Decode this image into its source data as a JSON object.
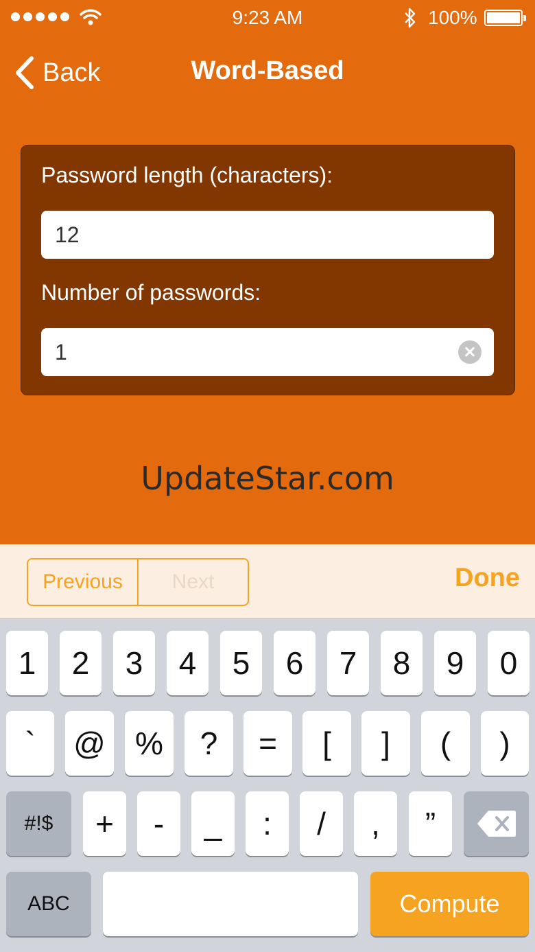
{
  "status_bar": {
    "time": "9:23 AM",
    "battery": "100%"
  },
  "nav": {
    "back_label": "Back",
    "title": "Word-Based"
  },
  "form": {
    "length_label": "Password length (characters):",
    "length_value": "12",
    "count_label": "Number of passwords:",
    "count_value": "1"
  },
  "watermark": "UpdateStar.com",
  "accessory": {
    "previous": "Previous",
    "next": "Next",
    "done": "Done"
  },
  "keyboard": {
    "row1": [
      "1",
      "2",
      "3",
      "4",
      "5",
      "6",
      "7",
      "8",
      "9",
      "0"
    ],
    "row2": [
      "`",
      "@",
      "%",
      "?",
      "=",
      "[",
      "]",
      "(",
      ")"
    ],
    "row3_mode": "#!$",
    "row3": [
      "+",
      "-",
      "_",
      ":",
      "/",
      ",",
      "”"
    ],
    "abc": "ABC",
    "compute": "Compute"
  },
  "colors": {
    "background": "#e46a0e",
    "panel": "#823700",
    "accent": "#f5a321"
  }
}
